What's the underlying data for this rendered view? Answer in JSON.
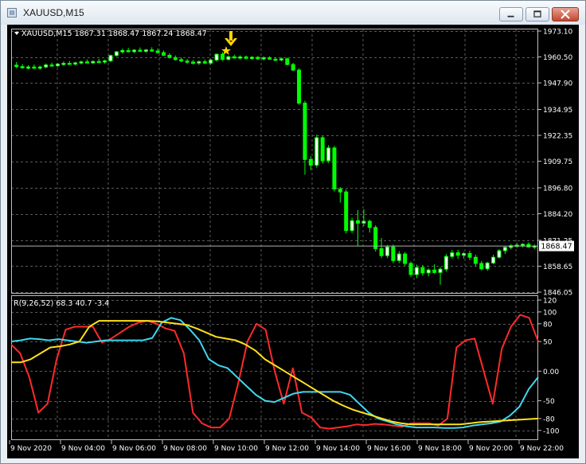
{
  "window": {
    "title": "XAUUSD,M15",
    "app_icon": "chart-window-icon",
    "controls": [
      "minimize",
      "maximize",
      "close"
    ]
  },
  "chart": {
    "info": "XAUUSD,M15  1867.31 1868.47 1867.24 1868.47",
    "current_price": "1868.47",
    "price_axis": [
      "1973.10",
      "1960.50",
      "1947.90",
      "1934.95",
      "1922.35",
      "1909.75",
      "1896.80",
      "1884.20",
      "1871.25",
      "1858.65",
      "1846.05"
    ],
    "price_min": 1846.05,
    "price_max": 1973.1,
    "arrow_marker_color": "#ffd700",
    "grid": true,
    "bull_color": "#ffffff",
    "bear_color": "#00ff00"
  },
  "chart_data": {
    "type": "candlestick",
    "title": "XAUUSD,M15",
    "x_tick_labels": [
      "9 Nov 2020",
      "9 Nov 04:00",
      "9 Nov 06:00",
      "9 Nov 08:00",
      "9 Nov 10:00",
      "9 Nov 12:00",
      "9 Nov 14:00",
      "9 Nov 16:00",
      "9 Nov 18:00",
      "9 Nov 20:00",
      "9 Nov 22:00"
    ],
    "ylim": [
      1846.05,
      1973.1
    ],
    "candles": [
      [
        1956.5,
        1958.0,
        1955.0,
        1955.8
      ],
      [
        1955.8,
        1957.0,
        1954.8,
        1955.2
      ],
      [
        1955.2,
        1956.5,
        1954.5,
        1955.6
      ],
      [
        1955.6,
        1956.8,
        1954.6,
        1955.0
      ],
      [
        1955.0,
        1956.3,
        1954.2,
        1955.6
      ],
      [
        1955.6,
        1957.3,
        1955.0,
        1956.6
      ],
      [
        1956.6,
        1957.8,
        1955.8,
        1956.2
      ],
      [
        1956.2,
        1957.6,
        1955.6,
        1957.0
      ],
      [
        1957.0,
        1958.3,
        1956.2,
        1957.4
      ],
      [
        1957.4,
        1958.6,
        1956.7,
        1957.0
      ],
      [
        1957.0,
        1958.2,
        1956.3,
        1957.6
      ],
      [
        1957.6,
        1958.8,
        1956.8,
        1958.1
      ],
      [
        1958.1,
        1959.3,
        1957.4,
        1957.6
      ],
      [
        1957.6,
        1958.8,
        1957.0,
        1958.3
      ],
      [
        1958.3,
        1959.6,
        1957.6,
        1958.0
      ],
      [
        1958.0,
        1959.2,
        1957.2,
        1958.6
      ],
      [
        1958.6,
        1961.6,
        1957.9,
        1961.2
      ],
      [
        1961.2,
        1963.4,
        1960.7,
        1963.0
      ],
      [
        1963.0,
        1964.6,
        1962.2,
        1963.6
      ],
      [
        1963.6,
        1964.9,
        1962.7,
        1963.1
      ],
      [
        1963.1,
        1964.3,
        1962.3,
        1963.8
      ],
      [
        1963.8,
        1965.1,
        1962.9,
        1963.2
      ],
      [
        1963.2,
        1964.4,
        1962.5,
        1963.9
      ],
      [
        1963.9,
        1965.2,
        1963.0,
        1963.4
      ],
      [
        1963.4,
        1964.6,
        1962.2,
        1962.6
      ],
      [
        1962.6,
        1963.6,
        1961.0,
        1961.3
      ],
      [
        1961.3,
        1962.3,
        1959.7,
        1960.2
      ],
      [
        1960.2,
        1961.2,
        1958.7,
        1959.2
      ],
      [
        1959.2,
        1960.2,
        1957.9,
        1958.5
      ],
      [
        1958.5,
        1959.5,
        1957.2,
        1958.0
      ],
      [
        1958.0,
        1959.0,
        1956.8,
        1957.5
      ],
      [
        1957.5,
        1958.8,
        1956.6,
        1958.2
      ],
      [
        1958.2,
        1959.3,
        1957.0,
        1957.5
      ],
      [
        1957.5,
        1959.6,
        1956.8,
        1959.0
      ],
      [
        1959.0,
        1962.2,
        1958.3,
        1961.8
      ],
      [
        1961.8,
        1962.8,
        1958.6,
        1959.3
      ],
      [
        1959.3,
        1961.2,
        1958.7,
        1960.6
      ],
      [
        1960.6,
        1961.6,
        1959.6,
        1960.0
      ],
      [
        1960.0,
        1961.3,
        1959.3,
        1960.5
      ],
      [
        1960.5,
        1961.2,
        1959.4,
        1959.8
      ],
      [
        1959.8,
        1960.9,
        1959.1,
        1960.3
      ],
      [
        1960.3,
        1961.0,
        1959.2,
        1959.6
      ],
      [
        1959.6,
        1960.8,
        1958.8,
        1960.1
      ],
      [
        1960.1,
        1960.9,
        1959.2,
        1959.4
      ],
      [
        1959.4,
        1960.4,
        1958.5,
        1959.0
      ],
      [
        1959.0,
        1960.2,
        1958.4,
        1959.6
      ],
      [
        1959.6,
        1960.2,
        1956.4,
        1956.8
      ],
      [
        1956.8,
        1957.6,
        1953.6,
        1954.1
      ],
      [
        1954.1,
        1955.0,
        1937.2,
        1938.0
      ],
      [
        1938.0,
        1939.2,
        1903.2,
        1910.6
      ],
      [
        1910.6,
        1912.2,
        1905.4,
        1907.8
      ],
      [
        1907.8,
        1922.6,
        1906.6,
        1921.2
      ],
      [
        1921.2,
        1922.2,
        1908.6,
        1910.0
      ],
      [
        1910.0,
        1917.5,
        1908.9,
        1916.2
      ],
      [
        1916.2,
        1917.2,
        1895.0,
        1896.2
      ],
      [
        1896.2,
        1897.2,
        1889.6,
        1894.8
      ],
      [
        1894.8,
        1896.0,
        1874.6,
        1876.0
      ],
      [
        1876.0,
        1882.2,
        1874.8,
        1880.8
      ],
      [
        1880.8,
        1886.0,
        1868.4,
        1879.6
      ],
      [
        1879.6,
        1886.4,
        1878.2,
        1880.5
      ],
      [
        1880.5,
        1881.3,
        1875.0,
        1877.5
      ],
      [
        1877.5,
        1878.6,
        1865.8,
        1867.2
      ],
      [
        1867.2,
        1872.4,
        1862.6,
        1863.8
      ],
      [
        1863.8,
        1869.0,
        1862.6,
        1868.0
      ],
      [
        1868.0,
        1869.2,
        1860.2,
        1861.4
      ],
      [
        1861.4,
        1866.0,
        1860.1,
        1864.6
      ],
      [
        1864.6,
        1865.6,
        1858.8,
        1860.0
      ],
      [
        1860.0,
        1861.0,
        1853.4,
        1854.6
      ],
      [
        1854.6,
        1859.4,
        1852.8,
        1858.0
      ],
      [
        1858.0,
        1859.3,
        1854.0,
        1855.4
      ],
      [
        1855.4,
        1857.6,
        1853.8,
        1856.8
      ],
      [
        1856.8,
        1859.6,
        1855.0,
        1855.6
      ],
      [
        1855.6,
        1858.2,
        1849.6,
        1857.2
      ],
      [
        1857.2,
        1864.6,
        1856.0,
        1863.4
      ],
      [
        1863.4,
        1866.6,
        1862.4,
        1865.2
      ],
      [
        1865.2,
        1866.6,
        1862.2,
        1864.0
      ],
      [
        1864.0,
        1865.6,
        1862.4,
        1864.8
      ],
      [
        1864.8,
        1866.2,
        1861.6,
        1863.0
      ],
      [
        1863.0,
        1864.2,
        1858.6,
        1860.0
      ],
      [
        1860.0,
        1861.2,
        1856.6,
        1857.4
      ],
      [
        1857.4,
        1860.8,
        1856.4,
        1860.2
      ],
      [
        1860.2,
        1864.2,
        1859.6,
        1863.0
      ],
      [
        1863.0,
        1867.0,
        1862.4,
        1866.2
      ],
      [
        1866.2,
        1868.6,
        1864.6,
        1867.8
      ],
      [
        1867.8,
        1869.4,
        1866.8,
        1868.6
      ],
      [
        1868.6,
        1870.0,
        1867.6,
        1868.9
      ],
      [
        1868.9,
        1869.8,
        1867.8,
        1869.3
      ],
      [
        1869.3,
        1870.2,
        1867.6,
        1868.0
      ],
      [
        1868.0,
        1869.2,
        1867.0,
        1868.47
      ]
    ],
    "indicator": {
      "label": "R(9,26,52) 68.3 40.7 -3.4",
      "axis_labels": [
        "120",
        "100",
        "80",
        "50",
        "0.00",
        "-50",
        "-80",
        "-100"
      ],
      "ylim": [
        -107,
        120
      ],
      "series": [
        {
          "color": "#ff2a2a",
          "values": [
            45,
            30,
            -10,
            -70,
            -55,
            20,
            70,
            75,
            75,
            75,
            48,
            55,
            65,
            75,
            82,
            85,
            80,
            72,
            68,
            30,
            -70,
            -88,
            -95,
            -95,
            -80,
            -20,
            50,
            80,
            70,
            0,
            -55,
            5,
            -70,
            -78,
            -95,
            -97,
            -95,
            -93,
            -90,
            -91,
            -89,
            -90,
            -92,
            -94,
            -88,
            -88,
            -88,
            -92,
            -80,
            40,
            52,
            55,
            0,
            -55,
            38,
            75,
            95,
            90,
            50
          ]
        },
        {
          "color": "#3fd7ef",
          "values": [
            50,
            52,
            55,
            54,
            52,
            54,
            52,
            50,
            48,
            50,
            52,
            52,
            52,
            52,
            52,
            56,
            82,
            90,
            86,
            70,
            52,
            20,
            10,
            5,
            -10,
            -25,
            -40,
            -50,
            -52,
            -45,
            -38,
            -35,
            -35,
            -35,
            -35,
            -35,
            -40,
            -55,
            -70,
            -80,
            -85,
            -90,
            -93,
            -95,
            -95,
            -95,
            -96,
            -96,
            -95,
            -92,
            -90,
            -88,
            -85,
            -75,
            -60,
            -30,
            -10
          ]
        },
        {
          "color": "#ffe11a",
          "values": [
            15,
            15,
            20,
            30,
            40,
            42,
            45,
            50,
            75,
            85,
            85,
            85,
            85,
            85,
            85,
            84,
            82,
            80,
            78,
            72,
            65,
            58,
            55,
            52,
            45,
            35,
            20,
            10,
            0,
            -10,
            -20,
            -30,
            -40,
            -50,
            -58,
            -65,
            -70,
            -75,
            -80,
            -85,
            -88,
            -90,
            -90,
            -90,
            -90,
            -90,
            -90,
            -88,
            -86,
            -85,
            -84,
            -83,
            -82,
            -81,
            -80
          ]
        }
      ]
    }
  }
}
